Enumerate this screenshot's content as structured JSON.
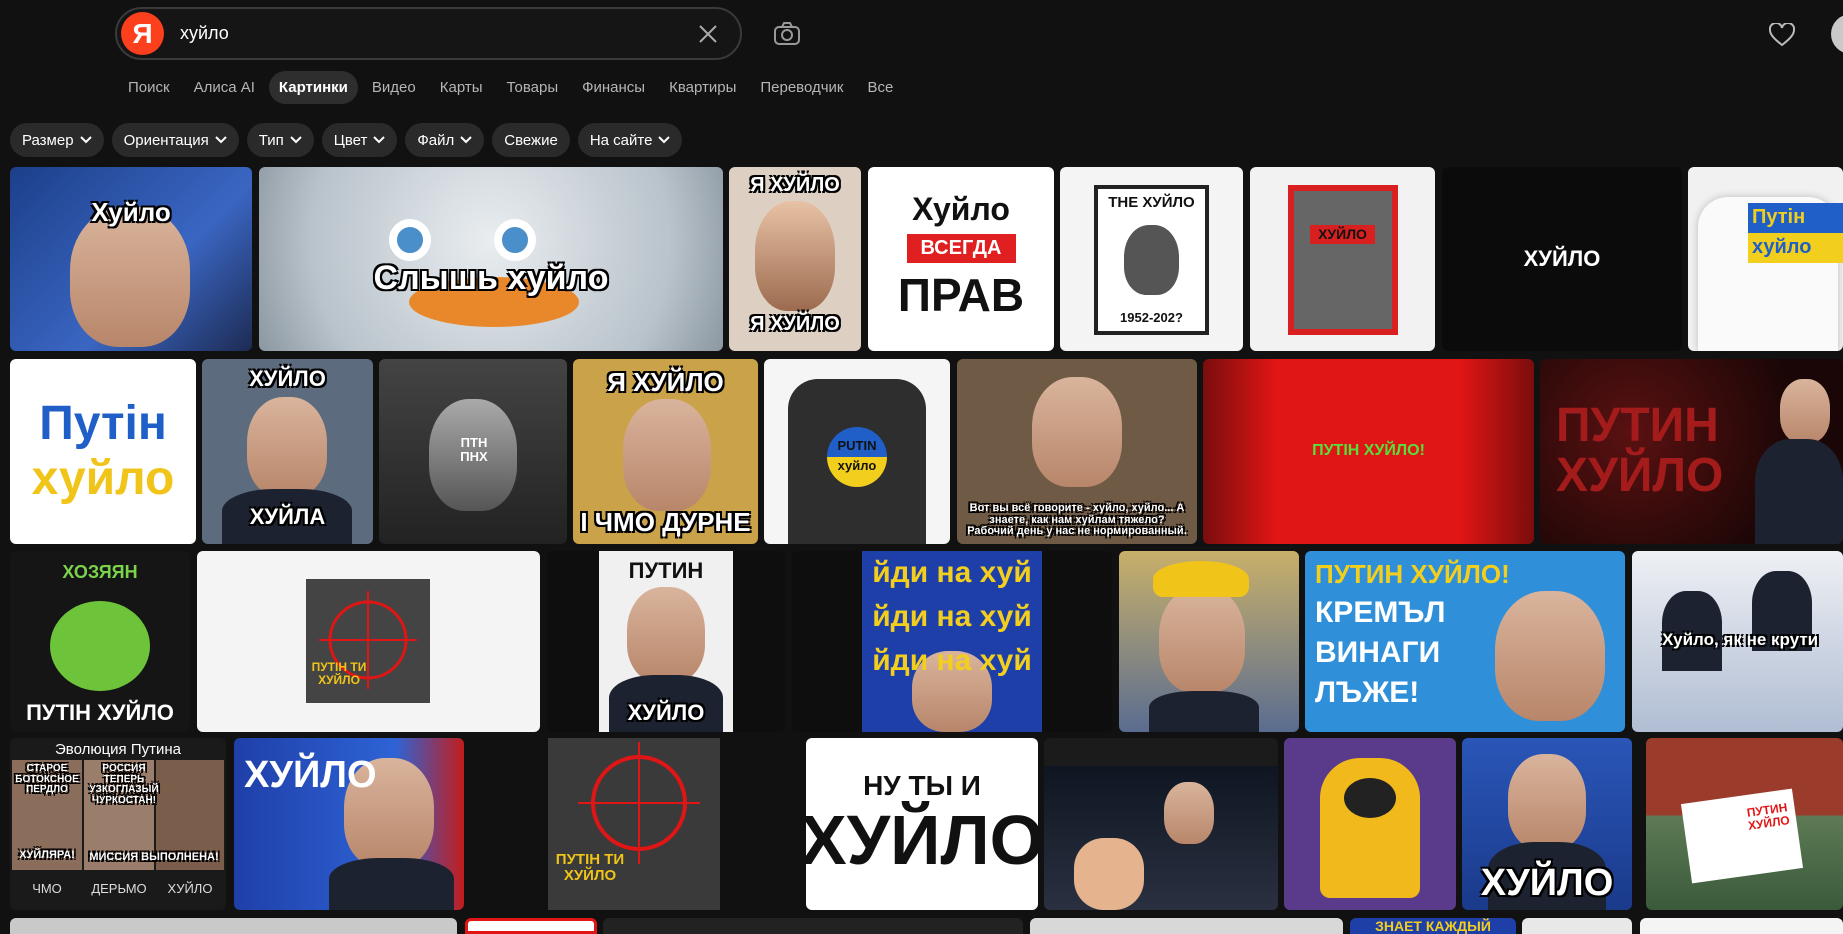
{
  "search": {
    "logo_letter": "Я",
    "query": "хуйло"
  },
  "tabs": [
    {
      "label": "Поиск"
    },
    {
      "label": "Алиса AI"
    },
    {
      "label": "Картинки",
      "active": true
    },
    {
      "label": "Видео"
    },
    {
      "label": "Карты"
    },
    {
      "label": "Товары"
    },
    {
      "label": "Финансы"
    },
    {
      "label": "Квартиры"
    },
    {
      "label": "Переводчик"
    },
    {
      "label": "Все"
    }
  ],
  "filters": [
    {
      "label": "Размер",
      "dropdown": true
    },
    {
      "label": "Ориентация",
      "dropdown": true
    },
    {
      "label": "Тип",
      "dropdown": true
    },
    {
      "label": "Цвет",
      "dropdown": true
    },
    {
      "label": "Файл",
      "dropdown": true
    },
    {
      "label": "Свежие",
      "dropdown": false
    },
    {
      "label": "На сайте",
      "dropdown": true
    }
  ],
  "tiles": {
    "r1_1": "Хуйло",
    "r1_2": "Слышь хуйло",
    "r1_3_top": "Я ХУЙЛО",
    "r1_3_bot": "Я ХУЙЛО",
    "r1_4_a": "Хуйло",
    "r1_4_b": "ВСЕГДА",
    "r1_4_c": "ПРАВ",
    "r1_5_top": "THE ХУЙЛО",
    "r1_5_bot": "1952-202?",
    "r1_6": "ХУЙЛО",
    "r1_7": "ХУЙЛО",
    "r1_8_a": "Путін",
    "r1_8_b": "хуйло",
    "r2_1_a": "Путін",
    "r2_1_b": "хуйло",
    "r2_2_top": "ХУЙЛО",
    "r2_2_bot": "ХУЙЛА",
    "r2_3": "ПТН ПНХ",
    "r2_4_top": "Я ХУЙЛО",
    "r2_4_bot": "І ЧМО ДУРНЕ",
    "r2_5_a": "PUTIN",
    "r2_5_b": "хуйло",
    "r2_6": "Вот вы всё говорите - хуйло, хуйло... А знаете, как нам хуйлам тяжело? Рабочий день у нас не нормированный.",
    "r2_7": "ПУТІН ХУЙЛО!",
    "r2_8": "ПУТИН ХУЙЛО",
    "r3_1_top": "ХОЗЯЯН",
    "r3_1_bot": "ПУТІН ХУЙЛО",
    "r3_2": "ПУТІН ТИ ХУЙЛО",
    "r3_3_top": "ПУТИН",
    "r3_3_bot": "ХУЙЛО",
    "r3_4": "йди на хуй",
    "r3_6_a": "ПУТИН ХУЙЛО!",
    "r3_6_b": "КРЕМЪЛ",
    "r3_6_c": "ВИНАГИ",
    "r3_6_d": "ЛЪЖЕ!",
    "r3_7": "Хуйло, як не крути",
    "r4_1_title": "Эволюция Путина",
    "r4_1_c1": "СТАРОЕ БОТОКСНОЕ ПЕРДЛО",
    "r4_1_c2": "РОССИЯ ТЕПЕРЬ УЗКОГЛАЗЫЙ ЧУРКОСТАН!",
    "r4_1_c3": "ХУЙЛЯРА!",
    "r4_1_c4": "МИССИЯ ВЫПОЛНЕНА!",
    "r4_1_l1": "ЧМО",
    "r4_1_l2": "ДЕРЬМО",
    "r4_1_l3": "ХУЙЛО",
    "r4_2": "ХУЙЛО",
    "r4_3": "ПУТІН ТИ ХУЙЛО",
    "r4_4_a": "НУ ТЫ И",
    "r4_4_b": "ХУЙЛО",
    "r4_7": "ХУЙЛО",
    "r4_8": "ПУТИН ХУЙЛО",
    "r5_4": "ЗНАЕТ КАЖДЫЙ"
  }
}
